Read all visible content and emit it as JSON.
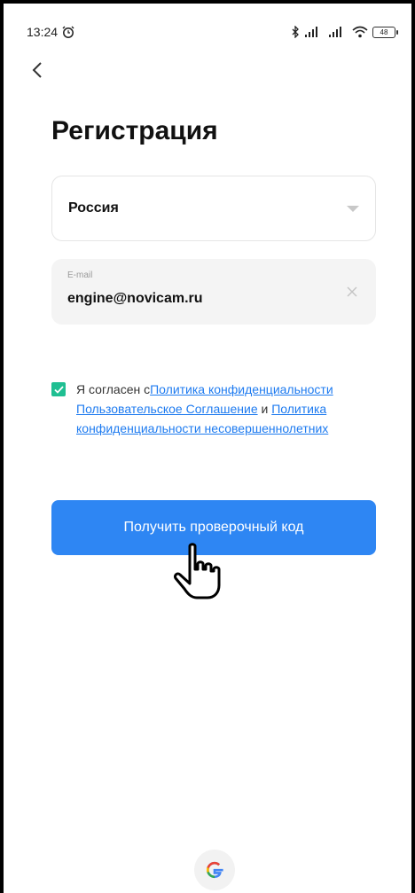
{
  "status_bar": {
    "time": "13:24",
    "alarm_icon": "alarm-icon",
    "bluetooth_icon": "bluetooth-icon",
    "signal_icons": [
      "signal-icon",
      "signal-icon"
    ],
    "wifi_icon": "wifi-icon",
    "battery": "48"
  },
  "nav": {
    "back_icon": "chevron-left-icon"
  },
  "page": {
    "title": "Регистрация"
  },
  "form": {
    "country": "Россия",
    "email_label": "E-mail",
    "email_value": "engine@novicam.ru"
  },
  "agreement": {
    "checked": true,
    "prefix": "Я согласен с",
    "link_privacy": "Политика конфиденциальности",
    "link_terms": "Пользовательское Соглашение",
    "and": " и ",
    "link_minors": "Политика конфиденциальности несовершеннолетних"
  },
  "actions": {
    "get_code_button": "Получить проверочный код"
  },
  "social": {
    "google_icon": "google-icon",
    "google_letter": "G"
  },
  "colors": {
    "primary": "#2e86f3",
    "checkbox": "#1fbf92",
    "link": "#1e7bf0"
  }
}
